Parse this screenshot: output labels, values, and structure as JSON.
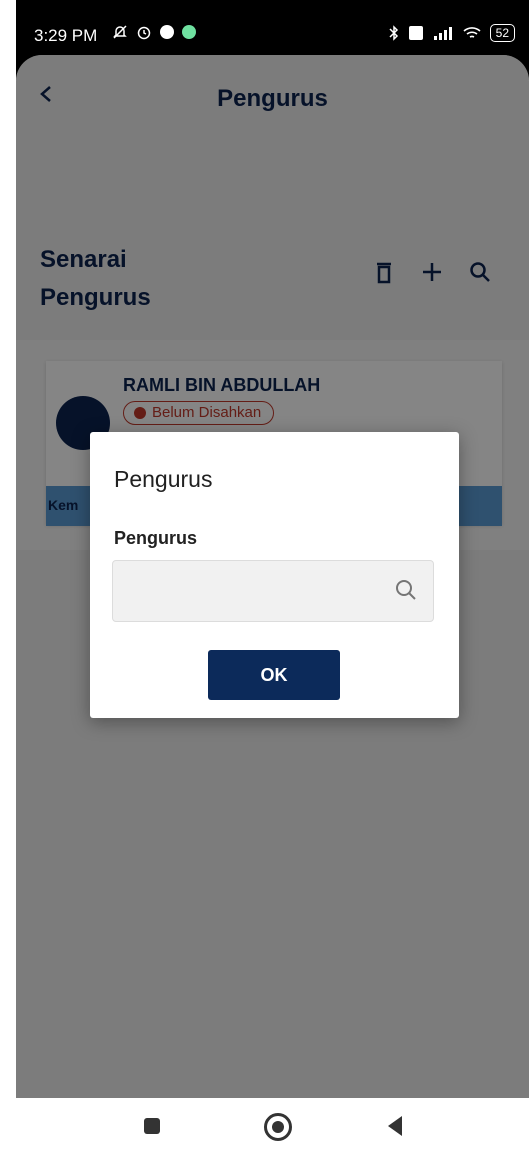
{
  "status_bar": {
    "time": "3:29 PM",
    "battery": "52"
  },
  "header": {
    "title": "Pengurus"
  },
  "section": {
    "title_line1": "Senarai",
    "title_line2": "Pengurus"
  },
  "list": [
    {
      "name": "RAMLI BIN ABDULLAH",
      "status": "Belum Disahkan",
      "footer_label": "Kem"
    }
  ],
  "dialog": {
    "title": "Pengurus",
    "field_label": "Pengurus",
    "field_value": "",
    "ok_label": "OK"
  },
  "colors": {
    "primary": "#0c2350",
    "badge": "#c0392b",
    "footer": "#5b9bd5"
  }
}
